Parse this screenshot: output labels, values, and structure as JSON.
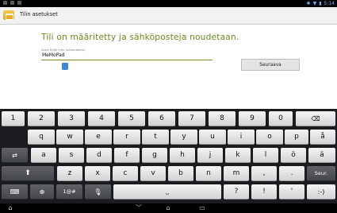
{
  "status_bar": {
    "time": "5:14"
  },
  "title_bar": {
    "title": "Tilin asetukset"
  },
  "content": {
    "heading": "Tili on määritetty ja sähköposteja noudetaan.",
    "name_label": "Anna tilille nimi (valinnainen)",
    "name_value": "MeMoPad",
    "next_button": "Seuraava"
  },
  "keyboard": {
    "row1": [
      "1",
      "2",
      "3",
      "4",
      "5",
      "6",
      "7",
      "8",
      "9",
      "0"
    ],
    "row2": [
      "q",
      "w",
      "e",
      "r",
      "t",
      "y",
      "u",
      "i",
      "o",
      "p",
      "å"
    ],
    "row3": [
      "a",
      "s",
      "d",
      "f",
      "g",
      "h",
      "j",
      "k",
      "l",
      "ö",
      "ä"
    ],
    "row4": [
      "z",
      "x",
      "c",
      "v",
      "b",
      "n",
      "m",
      ",",
      "."
    ],
    "enter_label": "Seur.",
    "symbols_label": "1@#",
    "question": "?",
    "exclaim": "!",
    "apostrophe": "'",
    "smiley": ":-)",
    "icons": {
      "backspace": "backspace-icon",
      "tab": "tab-icon",
      "shift": "shift-icon",
      "keyboard_settings": "keyboard-icon",
      "globe": "globe-icon",
      "mic": "mic-icon",
      "space": "space-icon",
      "nav_back": "back-icon",
      "nav_home": "home-icon",
      "nav_recent": "recent-apps-icon",
      "nav_hide": "hide-keyboard-icon"
    }
  }
}
